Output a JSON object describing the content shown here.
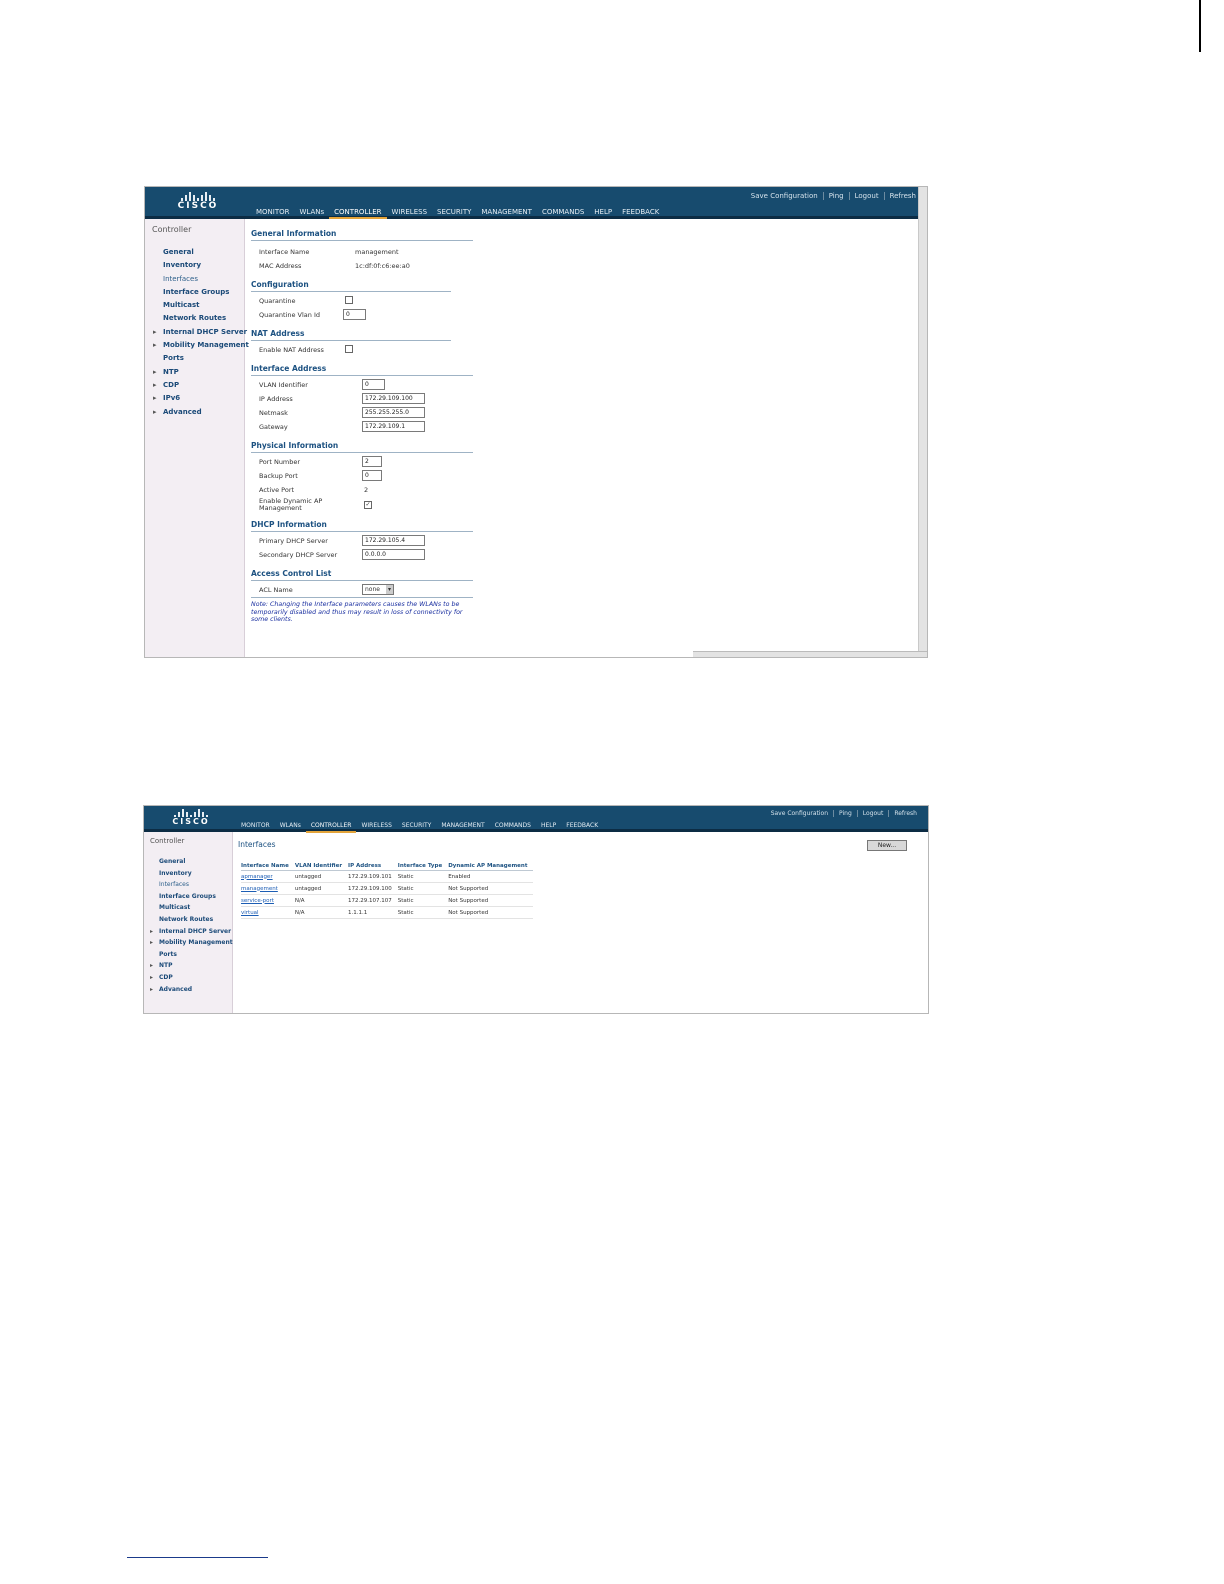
{
  "brand": "CISCO",
  "top_links": [
    "Save Configuration",
    "Ping",
    "Logout",
    "Refresh"
  ],
  "nav": [
    "MONITOR",
    "WLANs",
    "CONTROLLER",
    "WIRELESS",
    "SECURITY",
    "MANAGEMENT",
    "COMMANDS",
    "HELP",
    "FEEDBACK"
  ],
  "active_nav": "CONTROLLER",
  "sidebar_title": "Controller",
  "screen1": {
    "sidebar": [
      "General",
      "Inventory",
      "Interfaces",
      "Interface Groups",
      "Multicast",
      "Network Routes",
      "Internal DHCP Server",
      "Mobility Management",
      "Ports",
      "NTP",
      "CDP",
      "IPv6",
      "Advanced"
    ],
    "general_info_title": "General Information",
    "interface_name_label": "Interface Name",
    "interface_name_value": "management",
    "mac_label": "MAC Address",
    "mac_value": "1c:df:0f:c6:ee:a0",
    "configuration_title": "Configuration",
    "quarantine_label": "Quarantine",
    "quarantine_vlan_label": "Quarantine Vlan Id",
    "quarantine_vlan_value": "0",
    "nat_title": "NAT Address",
    "enable_nat_label": "Enable NAT Address",
    "iface_addr_title": "Interface Address",
    "vlan_id_label": "VLAN Identifier",
    "vlan_id_value": "0",
    "ip_label": "IP Address",
    "ip_value": "172.29.109.100",
    "netmask_label": "Netmask",
    "netmask_value": "255.255.255.0",
    "gateway_label": "Gateway",
    "gateway_value": "172.29.109.1",
    "physical_title": "Physical Information",
    "port_number_label": "Port Number",
    "port_number_value": "2",
    "backup_port_label": "Backup Port",
    "backup_port_value": "0",
    "active_port_label": "Active Port",
    "active_port_value": "2",
    "dyn_ap_label_1": "Enable Dynamic AP",
    "dyn_ap_label_2": "Management",
    "dyn_ap_checked": "✓",
    "dhcp_title": "DHCP Information",
    "primary_dhcp_label": "Primary DHCP Server",
    "primary_dhcp_value": "172.29.105.4",
    "secondary_dhcp_label": "Secondary DHCP Server",
    "secondary_dhcp_value": "0.0.0.0",
    "acl_title": "Access Control List",
    "acl_label": "ACL Name",
    "acl_value": "none",
    "note": "Note: Changing the Interface parameters causes the WLANs to be temporarily disabled and thus may result in loss of connectivity for some clients."
  },
  "screen2": {
    "sidebar": [
      "General",
      "Inventory",
      "Interfaces",
      "Interface Groups",
      "Multicast",
      "Network Routes",
      "Internal DHCP Server",
      "Mobility Management",
      "Ports",
      "NTP",
      "CDP",
      "Advanced"
    ],
    "page_title": "Interfaces",
    "new_button": "New...",
    "columns": [
      "Interface Name",
      "VLAN Identifier",
      "IP Address",
      "Interface Type",
      "Dynamic AP Management"
    ],
    "rows": [
      [
        "apmanager",
        "untagged",
        "172.29.109.101",
        "Static",
        "Enabled"
      ],
      [
        "management",
        "untagged",
        "172.29.109.100",
        "Static",
        "Not Supported"
      ],
      [
        "service-port",
        "N/A",
        "172.29.107.107",
        "Static",
        "Not Supported"
      ],
      [
        "virtual",
        "N/A",
        "1.1.1.1",
        "Static",
        "Not Supported"
      ]
    ]
  }
}
